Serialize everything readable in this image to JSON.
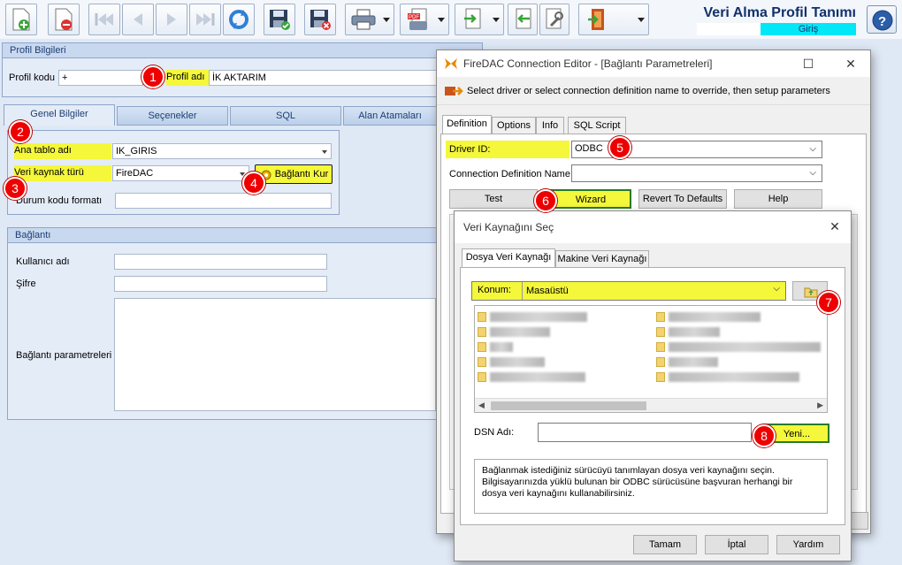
{
  "app": {
    "title": "Veri Alma Profil Tanımı",
    "mode": "Giriş"
  },
  "profil": {
    "group_title": "Profil Bilgileri",
    "kod_label": "Profil kodu",
    "kod_value": "+",
    "ad_label": "Profil adı",
    "ad_value": "İK AKTARIM"
  },
  "tabs": [
    "Genel Bilgiler",
    "Seçenekler",
    "SQL",
    "Alan Atamaları"
  ],
  "genel": {
    "ana_tablo_label": "Ana tablo adı",
    "ana_tablo_value": "IK_GIRIS",
    "veri_kaynak_label": "Veri kaynak türü",
    "veri_kaynak_value": "FireDAC",
    "baglanti_kur": "Bağlantı Kur",
    "durum_label": "Durum kodu formatı"
  },
  "baglanti": {
    "group_title": "Bağlantı",
    "kullanici_label": "Kullanıcı adı",
    "sifre_label": "Şifre",
    "param_label": "Bağlantı parametreleri"
  },
  "firedac": {
    "title": "FireDAC Connection Editor - [Bağlantı Parametreleri]",
    "subtitle": "Select driver or select connection definition name to override, then setup parameters",
    "tabs": [
      "Definition",
      "Options",
      "Info",
      "SQL Script"
    ],
    "driver_label": "Driver ID:",
    "driver_value": "ODBC",
    "conn_def_label": "Connection Definition Name:",
    "buttons": {
      "test": "Test",
      "wizard": "Wizard",
      "revert": "Revert To Defaults",
      "help": "Help"
    }
  },
  "vks": {
    "title": "Veri Kaynağını Seç",
    "tabs": [
      "Dosya Veri Kaynağı",
      "Makine Veri Kaynağı"
    ],
    "konum_label": "Konum:",
    "konum_value": "Masaüstü",
    "dsn_label": "DSN Adı:",
    "yeni": "Yeni...",
    "description": "Bağlanmak istediğiniz sürücüyü tanımlayan dosya veri kaynağını seçin. Bilgisayarınızda yüklü bulunan bir ODBC sürücüsüne başvuran herhangi bir dosya veri kaynağını kullanabilirsiniz.",
    "tamam": "Tamam",
    "iptal": "İptal",
    "yardim": "Yardım"
  },
  "badges": [
    "1",
    "2",
    "3",
    "4",
    "5",
    "6",
    "7",
    "8"
  ],
  "icons": [
    "new-doc-icon",
    "delete-doc-icon",
    "first-icon",
    "prev-icon",
    "next-icon",
    "last-icon",
    "refresh-icon",
    "save-icon",
    "cancel-save-icon",
    "print-icon",
    "pdf-icon",
    "export-icon",
    "import-icon",
    "tools-icon",
    "exit-icon",
    "help-icon"
  ],
  "colors": {
    "highlight": "#f4f73a",
    "badge": "#e00000",
    "mode_bg": "#00e8f8",
    "title": "#10306b"
  }
}
